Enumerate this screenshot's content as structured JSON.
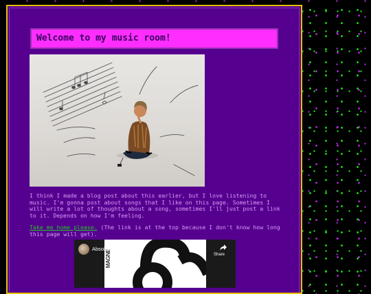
{
  "welcome": {
    "title": "Welcome to my music room!"
  },
  "intro": {
    "paragraph": "I think I made a blog post about this earlier, but I love listening to music. I'm gonna post about songs that I like on this page. Sometimes I will write a lot of thoughts about a song, sometimes I'll just post a link to it. Depends on how I'm feeling."
  },
  "nav": {
    "home_link": "Take me home please.",
    "home_note": " (The link is at the top because I don't know how long this page will get)."
  },
  "video": {
    "title": "Absolutely Cuckoo",
    "share_label": "Share",
    "art_text": "MAGNE"
  },
  "colors": {
    "page_bg": "#560090",
    "frame_border": "#e6c200",
    "welcome_bg": "#ff2eff",
    "text": "#d79cf5",
    "link": "#20c720"
  },
  "icons": [
    "music-notes-drawing",
    "share-arrow-icon",
    "channel-avatar"
  ]
}
